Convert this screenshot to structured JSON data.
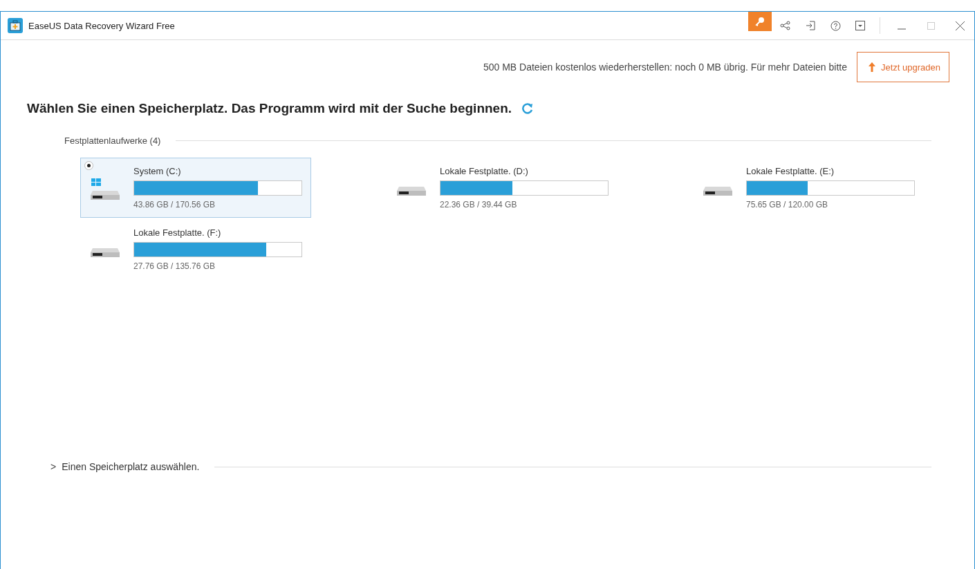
{
  "window": {
    "title": "EaseUS Data Recovery Wizard Free"
  },
  "notice": {
    "text": "500 MB Dateien kostenlos wiederherstellen: noch 0 MB übrig. Für mehr Dateien bitte",
    "button": "Jetzt upgraden"
  },
  "heading": "Wählen Sie einen Speicherplatz. Das Programm wird mit der Suche beginnen.",
  "drives_section": {
    "title": "Festplattenlaufwerke (4)",
    "drives": [
      {
        "name": "System (C:)",
        "kind": "system",
        "level": 0.74,
        "usage": "43.86 GB / 170.56 GB",
        "selected": true
      },
      {
        "name": "Lokale Festplatte. (D:)",
        "kind": "local",
        "level": 0.43,
        "usage": "22.36 GB / 39.44 GB",
        "selected": false
      },
      {
        "name": "Lokale Festplatte. (E:)",
        "kind": "local",
        "level": 0.365,
        "usage": "75.65 GB / 120.00 GB",
        "selected": false
      },
      {
        "name": "Lokale Festplatte. (F:)",
        "kind": "local",
        "level": 0.79,
        "usage": "27.76 GB / 135.76 GB",
        "selected": false
      }
    ]
  },
  "location_section": {
    "toggle": ">",
    "title": "Einen Speicherplatz auswählen.",
    "expanded": false
  }
}
